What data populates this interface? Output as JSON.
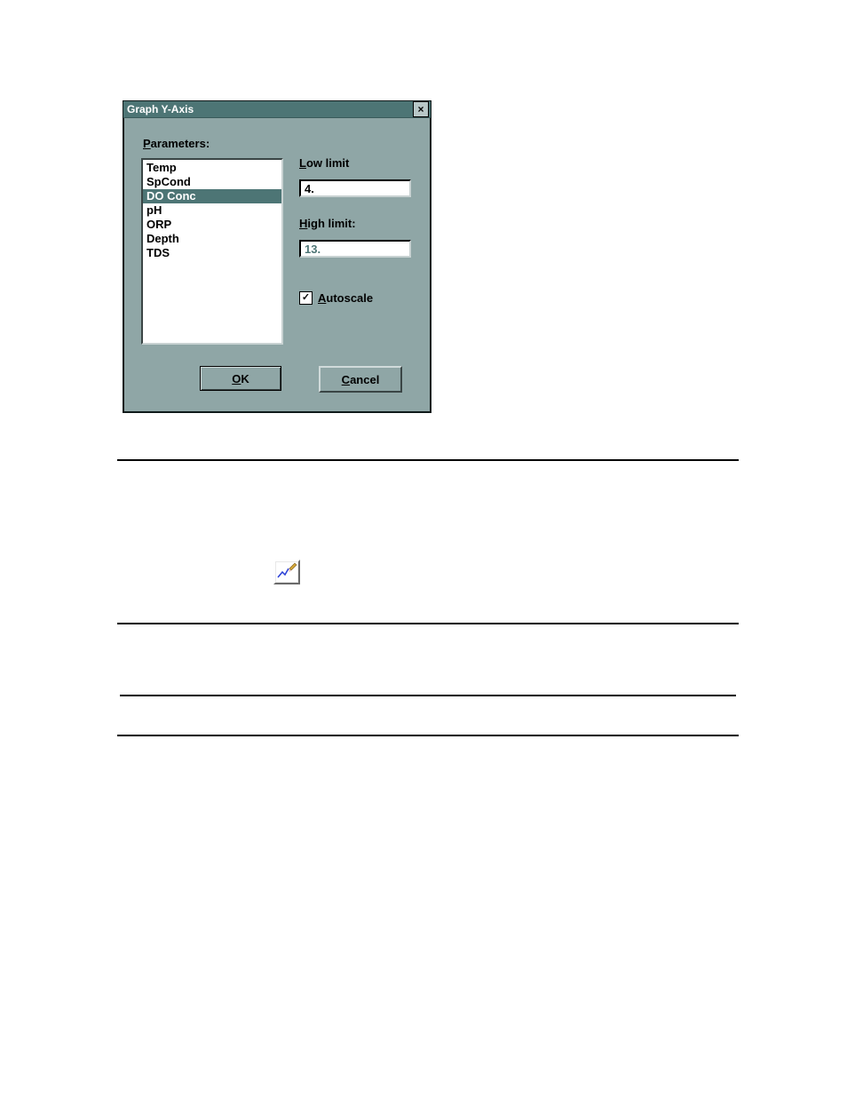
{
  "dialog": {
    "title": "Graph Y-Axis",
    "parameters_label": "Parameters:",
    "parameters_mnemonic": "P",
    "items": [
      "Temp",
      "SpCond",
      "DO Conc",
      "pH",
      "ORP",
      "Depth",
      "TDS"
    ],
    "selected_index": 2,
    "low_limit_label": "Low limit",
    "low_limit_mnemonic": "L",
    "low_limit_value": "4.",
    "high_limit_label": "High limit:",
    "high_limit_mnemonic": "H",
    "high_limit_value": "13.",
    "autoscale_label": "Autoscale",
    "autoscale_mnemonic": "A",
    "autoscale_checked": true,
    "ok_label": "OK",
    "ok_mnemonic": "O",
    "cancel_label": "Cancel",
    "cancel_mnemonic": "C"
  },
  "icons": {
    "redraw": "pencil-graph-icon"
  }
}
